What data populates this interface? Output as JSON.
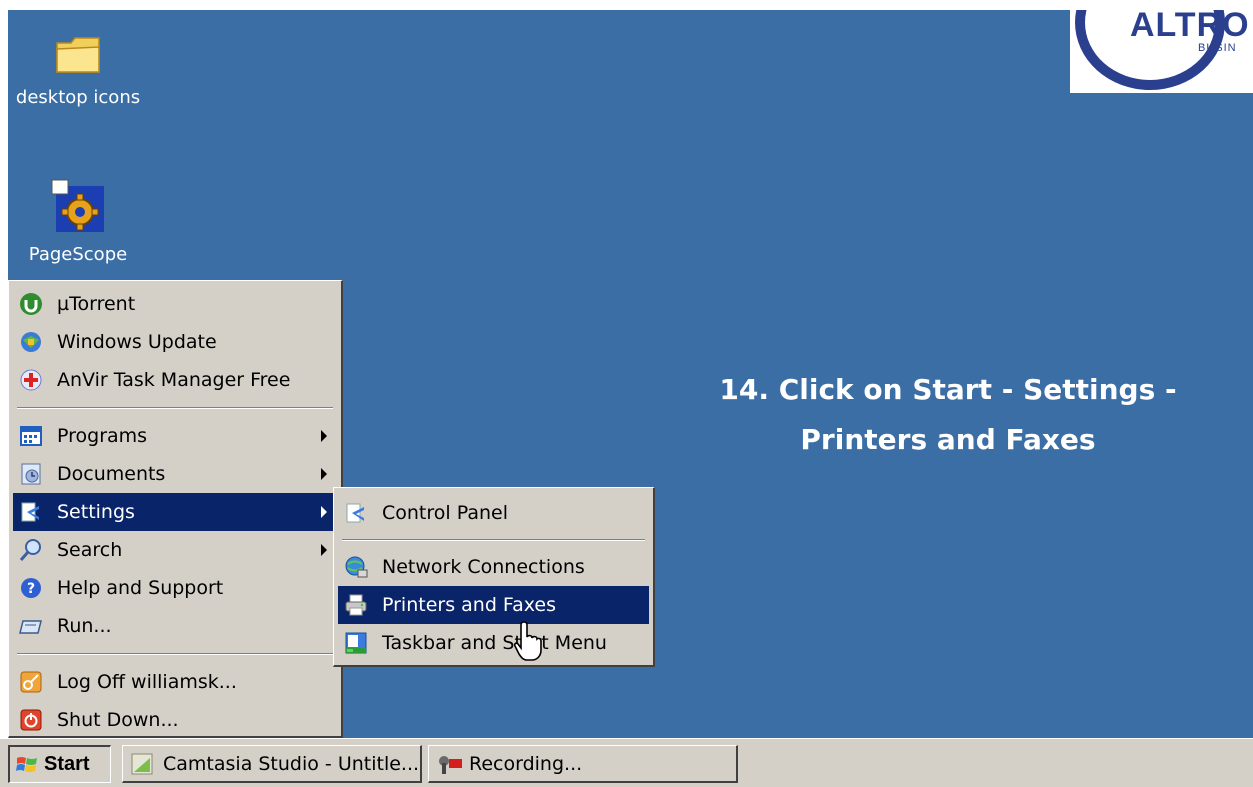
{
  "logo": {
    "word": "ALTRO",
    "sub": "BUSIN"
  },
  "desktop_icons": [
    {
      "label": "desktop icons",
      "icon": "folder-icon"
    },
    {
      "label": "PageScope",
      "icon": "gear-icon"
    }
  ],
  "instruction": {
    "line1": "14. Click on Start - Settings -",
    "line2": "Printers and Faxes"
  },
  "start_menu": {
    "pinned": [
      {
        "label": "µTorrent",
        "icon": "utorrent-icon"
      },
      {
        "label": "Windows Update",
        "icon": "windows-update-icon"
      },
      {
        "label": "AnVir Task Manager Free",
        "icon": "anvir-icon"
      }
    ],
    "main": [
      {
        "label": "Programs",
        "icon": "programs-icon",
        "submenu": true
      },
      {
        "label": "Documents",
        "icon": "documents-icon",
        "submenu": true
      },
      {
        "label": "Settings",
        "icon": "settings-icon",
        "submenu": true,
        "selected": true
      },
      {
        "label": "Search",
        "icon": "search-icon",
        "submenu": true
      },
      {
        "label": "Help and Support",
        "icon": "help-icon"
      },
      {
        "label": "Run...",
        "icon": "run-icon"
      }
    ],
    "session": [
      {
        "label": "Log Off williamsk...",
        "icon": "logoff-icon"
      },
      {
        "label": "Shut Down...",
        "icon": "shutdown-icon"
      }
    ]
  },
  "settings_submenu": [
    {
      "label": "Control Panel",
      "icon": "control-panel-icon"
    },
    {
      "label": "Network Connections",
      "icon": "network-icon"
    },
    {
      "label": "Printers and Faxes",
      "icon": "printer-icon",
      "selected": true
    },
    {
      "label": "Taskbar and Start Menu",
      "icon": "taskbar-icon"
    }
  ],
  "taskbar": {
    "start_label": "Start",
    "tasks": [
      {
        "label": "Camtasia Studio - Untitle...",
        "icon": "camtasia-icon"
      },
      {
        "label": "Recording...",
        "icon": "recording-icon"
      }
    ]
  },
  "colors": {
    "desktop": "#3a6ea5",
    "menu_bg": "#d4d0c8",
    "selection": "#0a246a"
  }
}
